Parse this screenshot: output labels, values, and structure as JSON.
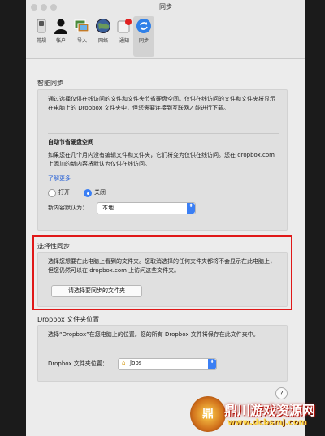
{
  "window": {
    "title": "同步"
  },
  "toolbar": {
    "items": [
      {
        "label": "常规",
        "icon": "switch-icon"
      },
      {
        "label": "帐户",
        "icon": "person-icon"
      },
      {
        "label": "导入",
        "icon": "photos-icon"
      },
      {
        "label": "网络",
        "icon": "globe-icon"
      },
      {
        "label": "通知",
        "icon": "notification-icon"
      },
      {
        "label": "同步",
        "icon": "sync-icon",
        "selected": true
      }
    ]
  },
  "smart_sync": {
    "title": "智能同步",
    "description": "通过选择仅供在线访问的文件和文件夹节省硬盘空间。仅供在线访问的文件和文件夹将显示在电脑上的 Dropbox 文件夹中，但您需要连接到互联网才能进行下载。",
    "auto_title": "自动节省硬盘空间",
    "auto_description": "如果您在几个月内没有编辑文件和文件夹，它们将变为仅供在线访问。您在 dropbox.com 上添加的新内容将默认为仅供在线访问。",
    "learn_more": "了解更多",
    "radio_on": "打开",
    "radio_off": "关闭",
    "selected_option": "关闭",
    "default_label": "新内容默认为：",
    "default_value": "本地"
  },
  "selective_sync": {
    "title": "选择性同步",
    "description": "选择您想要在此电脑上看到的文件夹。您取消选择的任何文件夹都将不会显示在此电脑上，但您仍然可以在 dropbox.com 上访问这些文件夹。",
    "button": "请选择要同步的文件夹"
  },
  "folder_location": {
    "title": "Dropbox 文件夹位置",
    "description": "选择“Dropbox”在您电脑上的位置。您的所有 Dropbox 文件将保存在此文件夹中。",
    "label": "Dropbox 文件夹位置：",
    "value": "Jobs"
  },
  "help": "?",
  "watermark": {
    "name": "鼎川游戏资源网",
    "url": "www.dcbsmj.com",
    "emblem": "鼎"
  },
  "colors": {
    "accent": "#3b7ff4",
    "highlight": "#e01818",
    "link": "#2a63d6"
  }
}
